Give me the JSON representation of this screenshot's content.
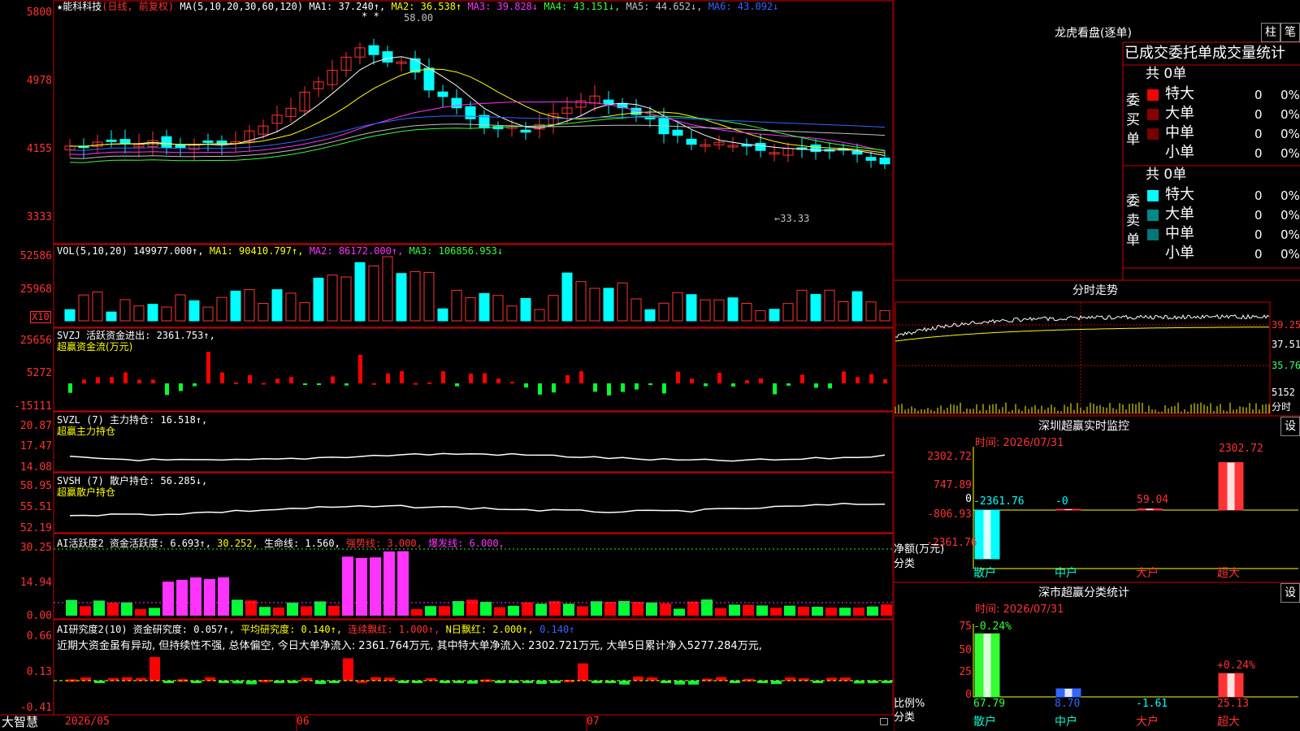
{
  "chart_header": {
    "star": "★",
    "stock": "能科科技",
    "mode": "(日线, 前复权)",
    "ma_params": "MA(5,10,20,30,60,120)",
    "ma1": "MA1: 37.240↑,",
    "ma2": "MA2: 36.538↑",
    "ma3": "MA3: 39.828↓",
    "ma4": "MA4: 43.151↓,",
    "ma5": "MA5: 44.652↓,",
    "ma6": "MA6: 43.092↓",
    "peak_marker": "58.00",
    "trough_marker": "←33.33",
    "star_marks": "* *"
  },
  "price_axis": [
    "5800",
    "4978",
    "4155",
    "3333"
  ],
  "vol": {
    "params": "VOL(5,10,20)",
    "value": "149977.000↑,",
    "ma1": "MA1: 90410.797↑,",
    "ma2": "MA2: 86172.000↑,",
    "ma3": "MA3: 106856.953↓",
    "axis": [
      "52586",
      "25968"
    ],
    "unit": "X10"
  },
  "svzj": {
    "title": "SVZJ  活跃资金进出: 2361.753↑,",
    "subtitle": "超赢资金流(万元)",
    "axis": [
      "25656",
      "5272",
      "-15111"
    ]
  },
  "svzl": {
    "title": "SVZL (7) 主力持仓: 16.518↑,",
    "subtitle": "超赢主力持仓",
    "axis": [
      "20.87",
      "17.47",
      "14.08"
    ]
  },
  "svsh": {
    "title": "SVSH (7) 散户持仓: 56.285↓,",
    "subtitle": "超赢散户持仓",
    "axis": [
      "58.95",
      "55.51",
      "52.19"
    ]
  },
  "ai1": {
    "title": "AI活跃度2 资金活跃度: 6.693↑,",
    "v2": "30.252,",
    "v3": "生命线: 1.560,",
    "v4": "强势线: 3.000,",
    "v5": "爆发线: 6.000,",
    "axis": [
      "30.25",
      "14.94",
      "0.00"
    ]
  },
  "ai2": {
    "title": "AI研究度2(10) 资金研究度: 0.057↑,",
    "v2": "平均研究度: 0.140↑,",
    "v3": "连续飘红: 1.000↑,",
    "v4": "N日飘红: 2.000↑,",
    "v5": "0.140↑",
    "comment": "近期大资金虽有异动, 但持续性不强, 总体偏空, 今日大单净流入: 2361.764万元, 其中特大单净流入: 2302.721万元, 大单5日累计净入5277.284万元,",
    "axis": [
      "0.66",
      "0.13",
      "-0.41"
    ]
  },
  "time_axis": [
    "2026/05",
    "06",
    "07"
  ],
  "brand": "大智慧",
  "lhb": {
    "title": "龙虎看盘(逐单)",
    "btn_bar": "柱",
    "btn_pen": "笔",
    "tabs": "已成交委托单成交量统计",
    "buy_label": "委买单",
    "sell_label": "委卖单",
    "buy_total": "共 0单",
    "sell_total": "共 0单",
    "rows": [
      {
        "name": "特大",
        "count": "0",
        "pct": "0%"
      },
      {
        "name": "大单",
        "count": "0",
        "pct": "0%"
      },
      {
        "name": "中单",
        "count": "0",
        "pct": "0%"
      },
      {
        "name": "小单",
        "count": "0",
        "pct": "0%"
      }
    ],
    "buy_colors": [
      "#ff0000",
      "#880000",
      "#770000",
      "#000000"
    ],
    "sell_colors": [
      "#00ffff",
      "#008888",
      "#007777",
      "#000000"
    ]
  },
  "intraday": {
    "title": "分时走势",
    "axis": [
      "39.25",
      "37.51",
      "35.76",
      "5152"
    ],
    "unit": "分时"
  },
  "sz_monitor": {
    "title": "深圳超赢实时监控",
    "btn": "设",
    "date": "时间: 2026/07/31",
    "axis": [
      "2302.72",
      "747.89",
      "0",
      "-806.93",
      "-2361.76"
    ],
    "ylabel": "净额(万元)",
    "xlabel": "分类",
    "bars": [
      {
        "cat": "散户",
        "value": -2361.76,
        "label": "-2361.76"
      },
      {
        "cat": "中户",
        "value": -0.0,
        "label": "-0"
      },
      {
        "cat": "大户",
        "value": 59.04,
        "label": "59.04"
      },
      {
        "cat": "超大",
        "value": 2302.72,
        "label": "2302.72"
      }
    ]
  },
  "sz_class": {
    "title": "深市超赢分类统计",
    "btn": "设",
    "date": "时间: 2026/07/31",
    "axis": [
      "75",
      "50",
      "25",
      "0"
    ],
    "ylabel": "比例%",
    "xlabel": "分类",
    "bars": [
      {
        "cat": "散户",
        "value": 67.79,
        "label": "67.79",
        "change": "-0.24%"
      },
      {
        "cat": "中户",
        "value": 8.7,
        "label": "8.70",
        "change": ""
      },
      {
        "cat": "大户",
        "value": -1.61,
        "label": "-1.61",
        "change": ""
      },
      {
        "cat": "超大",
        "value": 25.13,
        "label": "25.13",
        "change": "+0.24%"
      }
    ]
  },
  "chart_data": [
    {
      "type": "bar",
      "title": "深圳超赢实时监控",
      "categories": [
        "散户",
        "中户",
        "大户",
        "超大"
      ],
      "values": [
        -2361.76,
        -0.0,
        59.04,
        2302.72
      ],
      "ylabel": "净额(万元)",
      "xlabel": "分类",
      "ylim": [
        -2361.76,
        2302.72
      ]
    },
    {
      "type": "bar",
      "title": "深市超赢分类统计",
      "categories": [
        "散户",
        "中户",
        "大户",
        "超大"
      ],
      "values": [
        67.79,
        8.7,
        -1.61,
        25.13
      ],
      "ylabel": "比例%",
      "xlabel": "分类",
      "ylim": [
        0,
        75
      ]
    }
  ]
}
